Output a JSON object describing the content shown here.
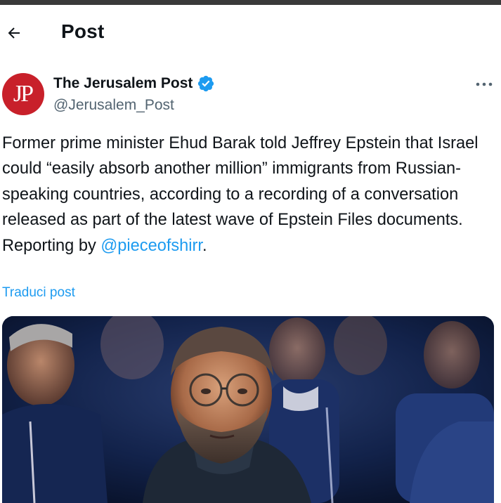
{
  "header": {
    "title": "Post",
    "back_icon": "arrow-left-icon"
  },
  "author": {
    "avatar_text": "JP",
    "avatar_color": "#c8202a",
    "name": "The Jerusalem Post",
    "handle": "@Jerusalem_Post",
    "verified": true,
    "verified_color": "#1d9bf0"
  },
  "more_icon": "more-horizontal-icon",
  "tweet": {
    "text": "Former prime minister Ehud Barak told Jeffrey Epstein that Israel could “easily absorb another million” immigrants from Russian-speaking countries, according to a recording of a conversation released as part of the latest wave of Epstein Files documents.",
    "reporting_prefix": "Reporting by ",
    "mention": "@pieceofshirr",
    "reporting_suffix": ".",
    "translate_label": "Traduci post"
  },
  "media": {
    "type": "photo",
    "description_icon": "photo-image"
  },
  "colors": {
    "accent": "#1d9bf0",
    "text": "#0f1419",
    "secondary": "#536471"
  }
}
